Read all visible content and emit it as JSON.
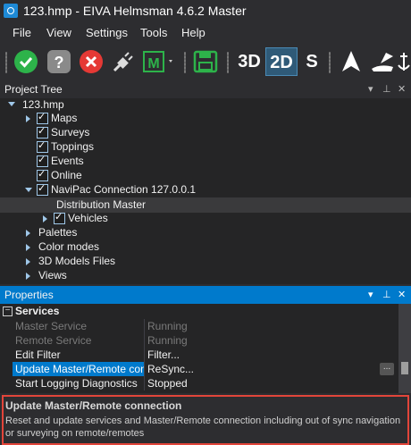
{
  "window": {
    "title": "123.hmp - EIVA Helmsman 4.6.2 Master"
  },
  "menu": [
    "File",
    "View",
    "Settings",
    "Tools",
    "Help"
  ],
  "toolbar": {
    "btn_3d": "3D",
    "btn_2d": "2D",
    "btn_s": "S",
    "btn_m": "M",
    "colors": {
      "green": "#2db34a",
      "red": "#e53935",
      "gray": "#8a8a8a",
      "active_bg": "#2f5a78"
    }
  },
  "project_tree": {
    "title": "Project Tree",
    "root": "123.hmp",
    "items": [
      "Maps",
      "Surveys",
      "Toppings",
      "Events",
      "Online",
      "NaviPac Connection 127.0.0.1",
      "Distribution Master",
      "Vehicles",
      "Palettes",
      "Color modes",
      "3D Models Files",
      "Views"
    ]
  },
  "properties": {
    "title": "Properties",
    "section": "Services",
    "rows": [
      {
        "name": "Master Service",
        "value": "Running"
      },
      {
        "name": "Remote Service",
        "value": "Running"
      },
      {
        "name": "Edit Filter",
        "value": "Filter..."
      },
      {
        "name": "Update Master/Remote conne",
        "value": "ReSync..."
      },
      {
        "name": "Start Logging Diagnostics",
        "value": "Stopped"
      }
    ],
    "ellipsis": "...",
    "description_title": "Update Master/Remote connection",
    "description_text": "Reset and update services and Master/Remote connection including out of sync navigation or surveying on remote/remotes"
  }
}
